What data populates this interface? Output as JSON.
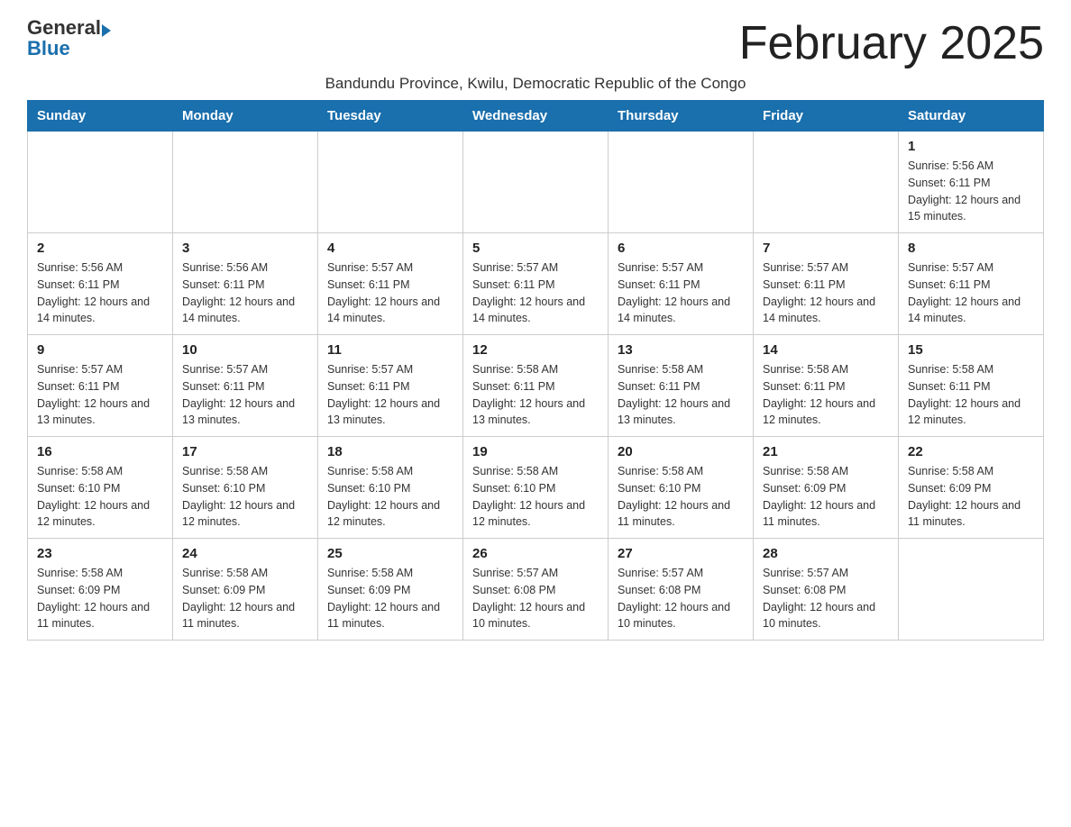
{
  "logo": {
    "general": "General",
    "blue": "Blue"
  },
  "title": "February 2025",
  "subtitle": "Bandundu Province, Kwilu, Democratic Republic of the Congo",
  "days_of_week": [
    "Sunday",
    "Monday",
    "Tuesday",
    "Wednesday",
    "Thursday",
    "Friday",
    "Saturday"
  ],
  "weeks": [
    {
      "days": [
        {
          "number": "",
          "info": ""
        },
        {
          "number": "",
          "info": ""
        },
        {
          "number": "",
          "info": ""
        },
        {
          "number": "",
          "info": ""
        },
        {
          "number": "",
          "info": ""
        },
        {
          "number": "",
          "info": ""
        },
        {
          "number": "1",
          "info": "Sunrise: 5:56 AM\nSunset: 6:11 PM\nDaylight: 12 hours and 15 minutes."
        }
      ]
    },
    {
      "days": [
        {
          "number": "2",
          "info": "Sunrise: 5:56 AM\nSunset: 6:11 PM\nDaylight: 12 hours and 14 minutes."
        },
        {
          "number": "3",
          "info": "Sunrise: 5:56 AM\nSunset: 6:11 PM\nDaylight: 12 hours and 14 minutes."
        },
        {
          "number": "4",
          "info": "Sunrise: 5:57 AM\nSunset: 6:11 PM\nDaylight: 12 hours and 14 minutes."
        },
        {
          "number": "5",
          "info": "Sunrise: 5:57 AM\nSunset: 6:11 PM\nDaylight: 12 hours and 14 minutes."
        },
        {
          "number": "6",
          "info": "Sunrise: 5:57 AM\nSunset: 6:11 PM\nDaylight: 12 hours and 14 minutes."
        },
        {
          "number": "7",
          "info": "Sunrise: 5:57 AM\nSunset: 6:11 PM\nDaylight: 12 hours and 14 minutes."
        },
        {
          "number": "8",
          "info": "Sunrise: 5:57 AM\nSunset: 6:11 PM\nDaylight: 12 hours and 14 minutes."
        }
      ]
    },
    {
      "days": [
        {
          "number": "9",
          "info": "Sunrise: 5:57 AM\nSunset: 6:11 PM\nDaylight: 12 hours and 13 minutes."
        },
        {
          "number": "10",
          "info": "Sunrise: 5:57 AM\nSunset: 6:11 PM\nDaylight: 12 hours and 13 minutes."
        },
        {
          "number": "11",
          "info": "Sunrise: 5:57 AM\nSunset: 6:11 PM\nDaylight: 12 hours and 13 minutes."
        },
        {
          "number": "12",
          "info": "Sunrise: 5:58 AM\nSunset: 6:11 PM\nDaylight: 12 hours and 13 minutes."
        },
        {
          "number": "13",
          "info": "Sunrise: 5:58 AM\nSunset: 6:11 PM\nDaylight: 12 hours and 13 minutes."
        },
        {
          "number": "14",
          "info": "Sunrise: 5:58 AM\nSunset: 6:11 PM\nDaylight: 12 hours and 12 minutes."
        },
        {
          "number": "15",
          "info": "Sunrise: 5:58 AM\nSunset: 6:11 PM\nDaylight: 12 hours and 12 minutes."
        }
      ]
    },
    {
      "days": [
        {
          "number": "16",
          "info": "Sunrise: 5:58 AM\nSunset: 6:10 PM\nDaylight: 12 hours and 12 minutes."
        },
        {
          "number": "17",
          "info": "Sunrise: 5:58 AM\nSunset: 6:10 PM\nDaylight: 12 hours and 12 minutes."
        },
        {
          "number": "18",
          "info": "Sunrise: 5:58 AM\nSunset: 6:10 PM\nDaylight: 12 hours and 12 minutes."
        },
        {
          "number": "19",
          "info": "Sunrise: 5:58 AM\nSunset: 6:10 PM\nDaylight: 12 hours and 12 minutes."
        },
        {
          "number": "20",
          "info": "Sunrise: 5:58 AM\nSunset: 6:10 PM\nDaylight: 12 hours and 11 minutes."
        },
        {
          "number": "21",
          "info": "Sunrise: 5:58 AM\nSunset: 6:09 PM\nDaylight: 12 hours and 11 minutes."
        },
        {
          "number": "22",
          "info": "Sunrise: 5:58 AM\nSunset: 6:09 PM\nDaylight: 12 hours and 11 minutes."
        }
      ]
    },
    {
      "days": [
        {
          "number": "23",
          "info": "Sunrise: 5:58 AM\nSunset: 6:09 PM\nDaylight: 12 hours and 11 minutes."
        },
        {
          "number": "24",
          "info": "Sunrise: 5:58 AM\nSunset: 6:09 PM\nDaylight: 12 hours and 11 minutes."
        },
        {
          "number": "25",
          "info": "Sunrise: 5:58 AM\nSunset: 6:09 PM\nDaylight: 12 hours and 11 minutes."
        },
        {
          "number": "26",
          "info": "Sunrise: 5:57 AM\nSunset: 6:08 PM\nDaylight: 12 hours and 10 minutes."
        },
        {
          "number": "27",
          "info": "Sunrise: 5:57 AM\nSunset: 6:08 PM\nDaylight: 12 hours and 10 minutes."
        },
        {
          "number": "28",
          "info": "Sunrise: 5:57 AM\nSunset: 6:08 PM\nDaylight: 12 hours and 10 minutes."
        },
        {
          "number": "",
          "info": ""
        }
      ]
    }
  ]
}
